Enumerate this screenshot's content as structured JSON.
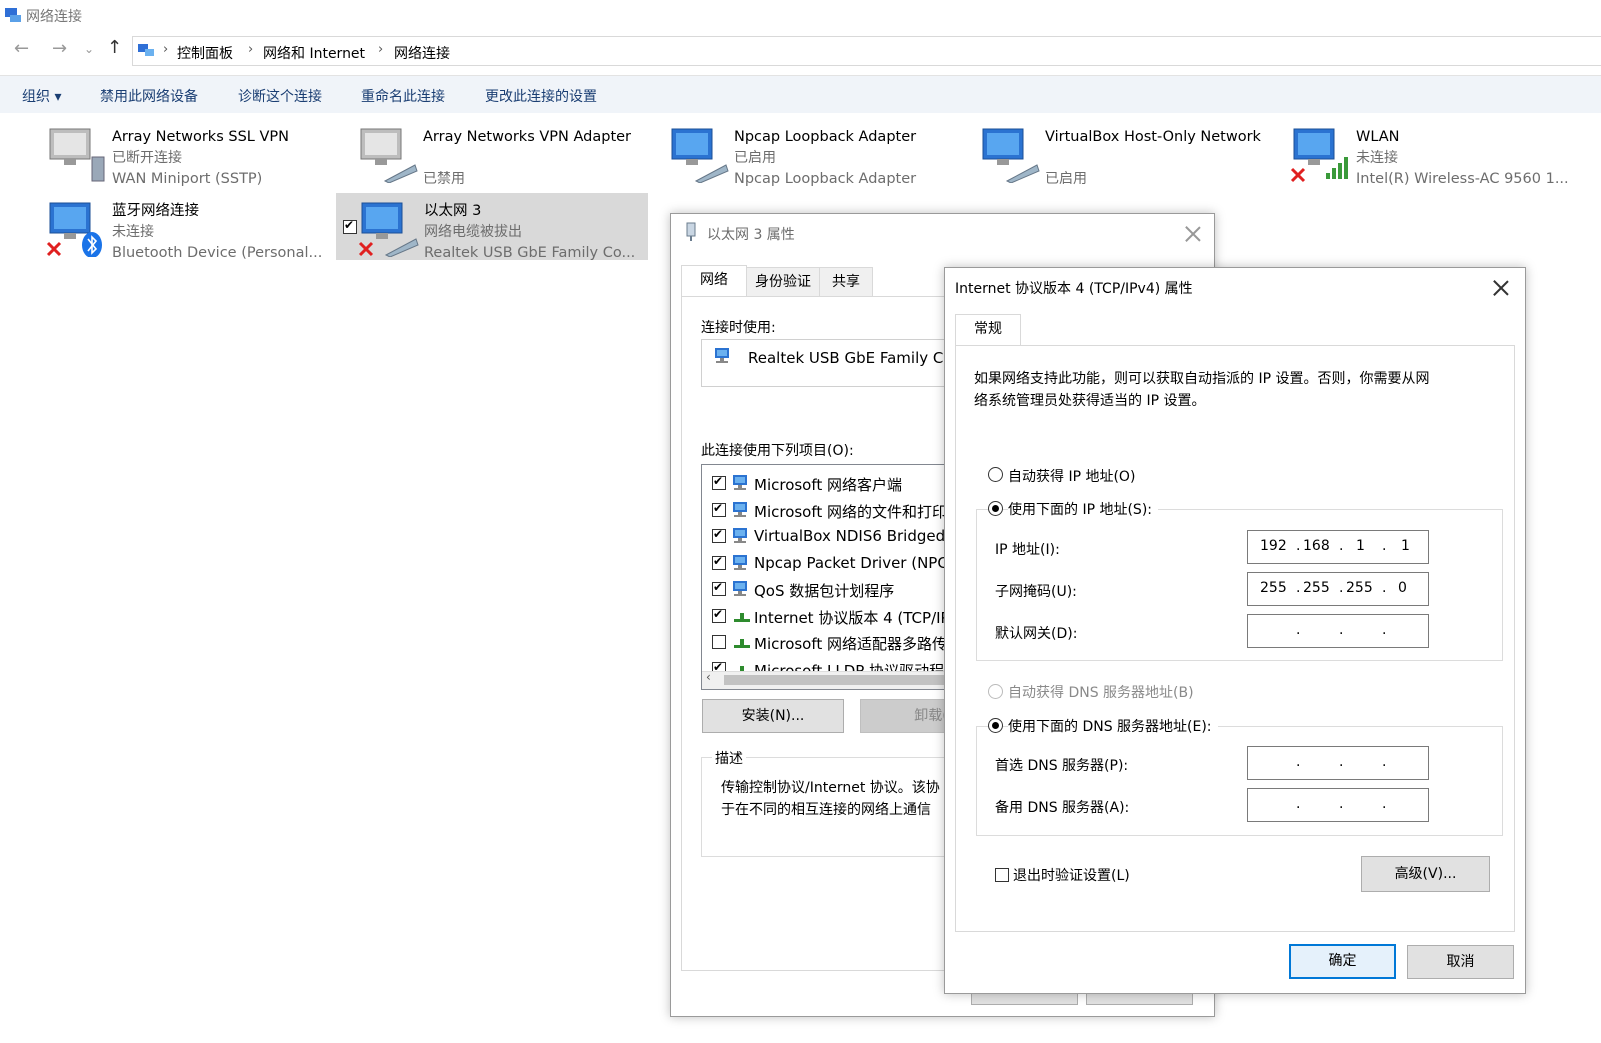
{
  "window": {
    "title": "网络连接"
  },
  "breadcrumb": [
    "控制面板",
    "网络和 Internet",
    "网络连接"
  ],
  "toolbar": [
    "组织 ▾",
    "禁用此网络设备",
    "诊断这个连接",
    "重命名此连接",
    "更改此连接的设置"
  ],
  "connections": [
    {
      "name": "Array Networks SSL VPN",
      "l2": "已断开连接",
      "l3": "WAN Miniport (SSTP)"
    },
    {
      "name": "Array Networks VPN Adapter",
      "l2": "已禁用",
      "l3": ""
    },
    {
      "name": "Npcap Loopback Adapter",
      "l2": "已启用",
      "l3": "Npcap Loopback Adapter"
    },
    {
      "name": "VirtualBox Host-Only Network",
      "l2": "已启用",
      "l3": ""
    },
    {
      "name": "WLAN",
      "l2": "未连接",
      "l3": "Intel(R) Wireless-AC 9560 1..."
    },
    {
      "name": "蓝牙网络连接",
      "l2": "未连接",
      "l3": "Bluetooth Device (Personal..."
    },
    {
      "name": "以太网 3",
      "l2": "网络电缆被拔出",
      "l3": "Realtek USB GbE Family Co..."
    }
  ],
  "props": {
    "title": "以太网 3 属性",
    "tabs": [
      "网络",
      "身份验证",
      "共享"
    ],
    "connect_using_label": "连接时使用:",
    "adapter": "Realtek USB GbE Family Co",
    "items_label": "此连接使用下列项目(O):",
    "items": [
      {
        "label": "Microsoft 网络客户端",
        "checked": true
      },
      {
        "label": "Microsoft 网络的文件和打印",
        "checked": true
      },
      {
        "label": "VirtualBox NDIS6 Bridged",
        "checked": true
      },
      {
        "label": "Npcap Packet Driver (NPC",
        "checked": true
      },
      {
        "label": "QoS 数据包计划程序",
        "checked": true
      },
      {
        "label": "Internet 协议版本 4 (TCP/IP",
        "checked": true
      },
      {
        "label": "Microsoft 网络适配器多路传",
        "checked": false
      },
      {
        "label": "Microsoft LLDP 协议驱动程",
        "checked": true
      }
    ],
    "install": "安装(N)...",
    "uninstall": "卸载(",
    "desc_label": "描述",
    "desc_line1": "传输控制协议/Internet 协议。该协",
    "desc_line2": "于在不同的相互连接的网络上通信"
  },
  "ipv4": {
    "title": "Internet 协议版本 4 (TCP/IPv4) 属性",
    "tab": "常规",
    "intro1": "如果网络支持此功能，则可以获取自动指派的 IP 设置。否则，你需要从网",
    "intro2": "络系统管理员处获得适当的 IP 设置。",
    "auto_ip": "自动获得 IP 地址(O)",
    "manual_ip": "使用下面的 IP 地址(S):",
    "ip_label": "IP 地址(I):",
    "ip": [
      "192",
      "168",
      "1",
      "1"
    ],
    "mask_label": "子网掩码(U):",
    "mask": [
      "255",
      "255",
      "255",
      "0"
    ],
    "gw_label": "默认网关(D):",
    "auto_dns": "自动获得 DNS 服务器地址(B)",
    "manual_dns": "使用下面的 DNS 服务器地址(E):",
    "dns1_label": "首选 DNS 服务器(P):",
    "dns2_label": "备用 DNS 服务器(A):",
    "validate": "退出时验证设置(L)",
    "advanced": "高级(V)...",
    "ok": "确定",
    "cancel": "取消"
  }
}
